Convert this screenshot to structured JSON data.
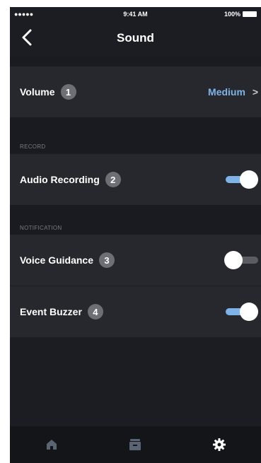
{
  "status_bar": {
    "signal": "●●●●● ",
    "time": "9:41 AM",
    "battery": "100%"
  },
  "header": {
    "title": "Sound"
  },
  "rows": [
    {
      "label": "Volume",
      "badge": "1",
      "value": "Medium"
    },
    {
      "label": "Audio Recording",
      "badge": "2",
      "toggle_on": true
    },
    {
      "label": "Voice Guidance",
      "badge": "3",
      "toggle_on": false
    },
    {
      "label": "Event Buzzer",
      "badge": "4",
      "toggle_on": true
    }
  ],
  "sections": {
    "record": "RECORD",
    "notification": "NOTIFICATION"
  },
  "tabbar": {
    "items": [
      "home-icon",
      "archive-icon",
      "gear-icon"
    ],
    "active": 2
  },
  "colors": {
    "accent": "#7fb3e8",
    "background": "#1c1d22",
    "row": "#27282e"
  }
}
